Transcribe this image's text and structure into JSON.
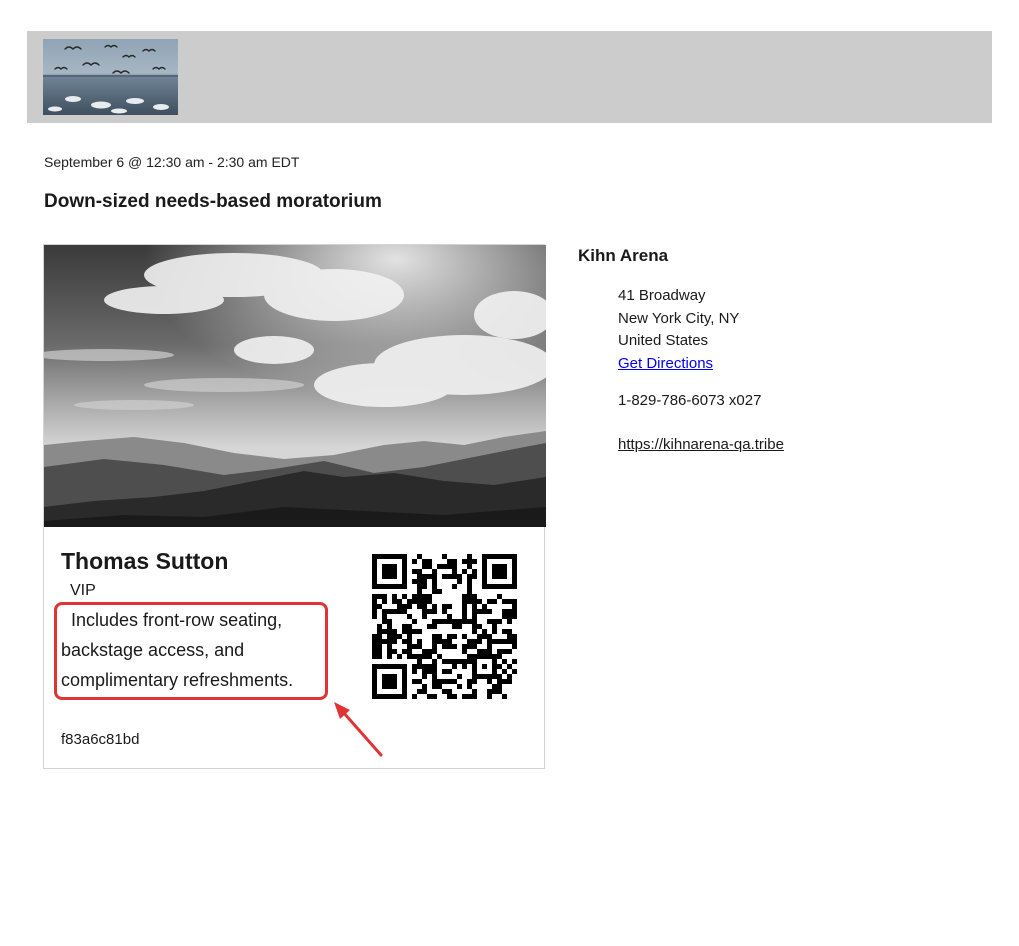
{
  "event": {
    "datetime": "September 6 @ 12:30 am - 2:30 am  EDT",
    "title": "Down-sized needs-based moratorium"
  },
  "ticket": {
    "attendee_name": "Thomas Sutton",
    "ticket_type": "VIP",
    "description": "Includes front-row seating, backstage access, and complimentary refreshments.",
    "code": "f83a6c81bd"
  },
  "venue": {
    "name": "Kihn Arena",
    "address_line1": "41 Broadway",
    "address_line2": "New York City, NY",
    "country": "United States",
    "directions_label": "Get Directions",
    "phone": "1-829-786-6073 x027",
    "website": "https://kihnarena-qa.tribe"
  },
  "colors": {
    "header_background": "#cccccc",
    "highlight": "#e03434",
    "link": "#0000ee"
  }
}
